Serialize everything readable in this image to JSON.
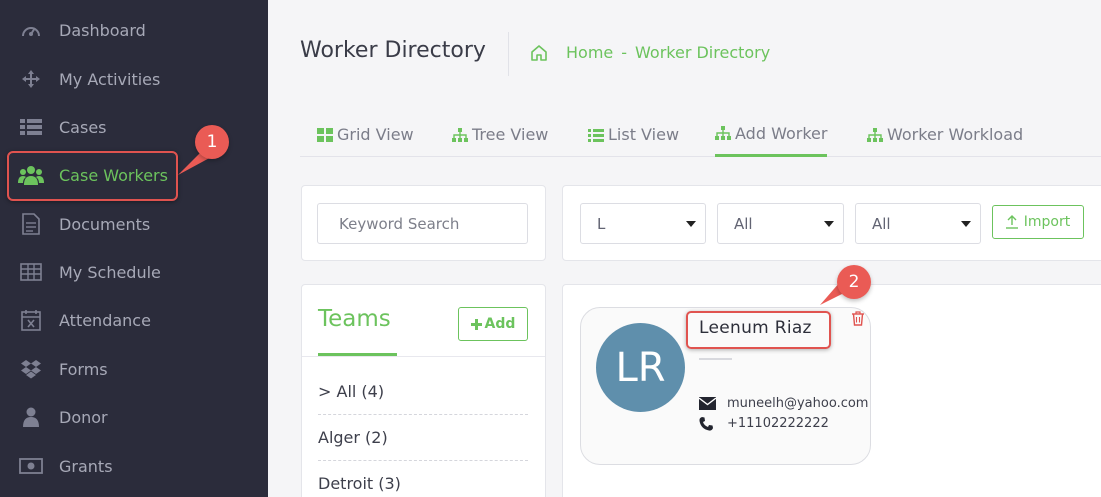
{
  "sidebar": {
    "items": [
      {
        "label": "Dashboard",
        "icon": "dashboard-icon"
      },
      {
        "label": "My Activities",
        "icon": "activities-icon"
      },
      {
        "label": "Cases",
        "icon": "cases-icon"
      },
      {
        "label": "Case Workers",
        "icon": "users-icon",
        "active": true
      },
      {
        "label": "Documents",
        "icon": "document-icon"
      },
      {
        "label": "My Schedule",
        "icon": "calendar-grid-icon"
      },
      {
        "label": "Attendance",
        "icon": "calendar-x-icon"
      },
      {
        "label": "Forms",
        "icon": "dropbox-icon"
      },
      {
        "label": "Donor",
        "icon": "user-icon"
      },
      {
        "label": "Grants",
        "icon": "money-icon"
      }
    ]
  },
  "annotations": {
    "badge1": "1",
    "badge2": "2"
  },
  "header": {
    "title": "Worker Directory",
    "breadcrumb": {
      "home": "Home",
      "separator": "-",
      "current": "Worker Directory"
    }
  },
  "tabs": [
    {
      "label": "Grid View",
      "icon": "grid-icon"
    },
    {
      "label": "Tree View",
      "icon": "sitemap-icon"
    },
    {
      "label": "List View",
      "icon": "list-icon"
    },
    {
      "label": "Add Worker",
      "icon": "sitemap-icon",
      "active": true
    },
    {
      "label": "Worker Workload",
      "icon": "sitemap-icon"
    }
  ],
  "search": {
    "placeholder": "Keyword Search"
  },
  "filters": [
    {
      "value": "L"
    },
    {
      "value": "All"
    },
    {
      "value": "All"
    }
  ],
  "import_label": "Import",
  "teams": {
    "title": "Teams",
    "add_label": "Add",
    "items": [
      "> All (4)",
      "Alger (2)",
      "Detroit (3)"
    ]
  },
  "worker": {
    "initials": "LR",
    "name": "Leenum Riaz",
    "email": "muneelh@yahoo.com",
    "phone": "+11102222222"
  },
  "colors": {
    "accent": "#6cc35d",
    "sidebar": "#2b2c3b",
    "highlight": "#e0534f",
    "avatar": "#5f8fac"
  }
}
